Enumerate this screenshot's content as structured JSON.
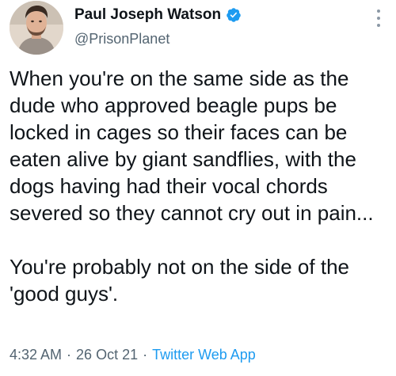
{
  "author": {
    "display_name": "Paul Joseph Watson",
    "handle": "@PrisonPlanet",
    "verified_icon": "verified-badge-icon"
  },
  "tweet": {
    "paragraph_1": "When you're on the same side as the dude who approved beagle pups be locked in cages so their faces can be eaten alive by giant sandflies, with the dogs having had their vocal chords severed so they cannot cry out in pain...",
    "paragraph_2": "You're probably not on the side of the 'good guys'."
  },
  "meta": {
    "time": "4:32 AM",
    "separator": "·",
    "date": "26 Oct 21",
    "source": "Twitter Web App"
  },
  "icons": {
    "more": "more-options-icon"
  },
  "colors": {
    "text": "#0f1419",
    "secondary": "#536471",
    "link": "#1d9bf0"
  }
}
